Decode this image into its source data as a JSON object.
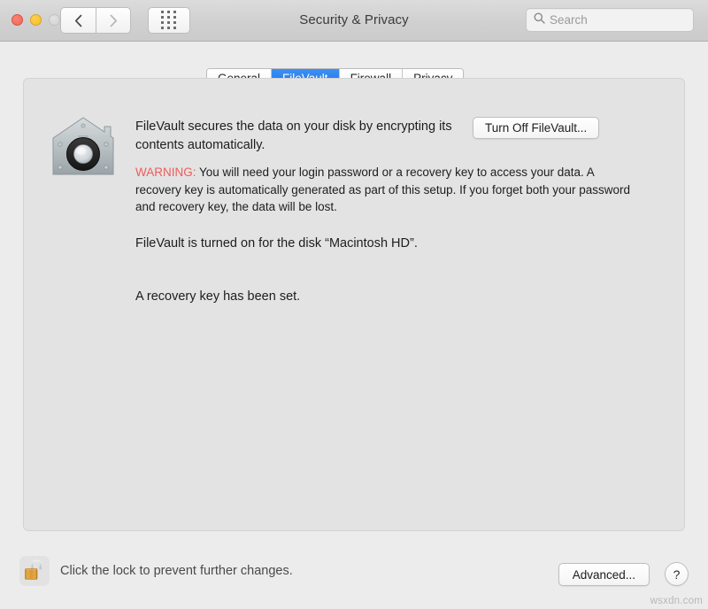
{
  "window": {
    "title": "Security & Privacy",
    "traffic_lights": [
      {
        "name": "close",
        "color": "#ed6a5e"
      },
      {
        "name": "minimize",
        "color": "#f5bd2e"
      },
      {
        "name": "zoom",
        "color": "#d2d2d2"
      }
    ],
    "nav": {
      "back_label": "‹",
      "forward_label": "›",
      "grid_label": "Show All"
    },
    "search": {
      "placeholder": "Search",
      "value": ""
    }
  },
  "tabs": [
    {
      "label": "General",
      "active": false
    },
    {
      "label": "FileVault",
      "active": true
    },
    {
      "label": "Firewall",
      "active": false
    },
    {
      "label": "Privacy",
      "active": false
    }
  ],
  "main": {
    "icon_name": "filevault-icon",
    "description": "FileVault secures the data on your disk by encrypting its contents automatically.",
    "warning_label": "WARNING:",
    "warning_body": " You will need your login password or a recovery key to access your data. A recovery key is automatically generated as part of this setup. If you forget both your password and recovery key, the data will be lost.",
    "status_line_1": "FileVault is turned on for the disk “Macintosh HD”.",
    "status_line_2": "A recovery key has been set.",
    "turn_off_button": "Turn Off FileVault..."
  },
  "footer": {
    "lock_state": "unlocked",
    "lock_text": "Click the lock to prevent further changes.",
    "advanced_button": "Advanced...",
    "help_button": "?"
  },
  "watermark": "wsxdn.com",
  "colors": {
    "accent": "#1f72e8",
    "warning": "#ef5b5b",
    "window_bg": "#ececec",
    "panel_bg": "#e3e3e3",
    "lock_gold": "#e8a33d"
  }
}
